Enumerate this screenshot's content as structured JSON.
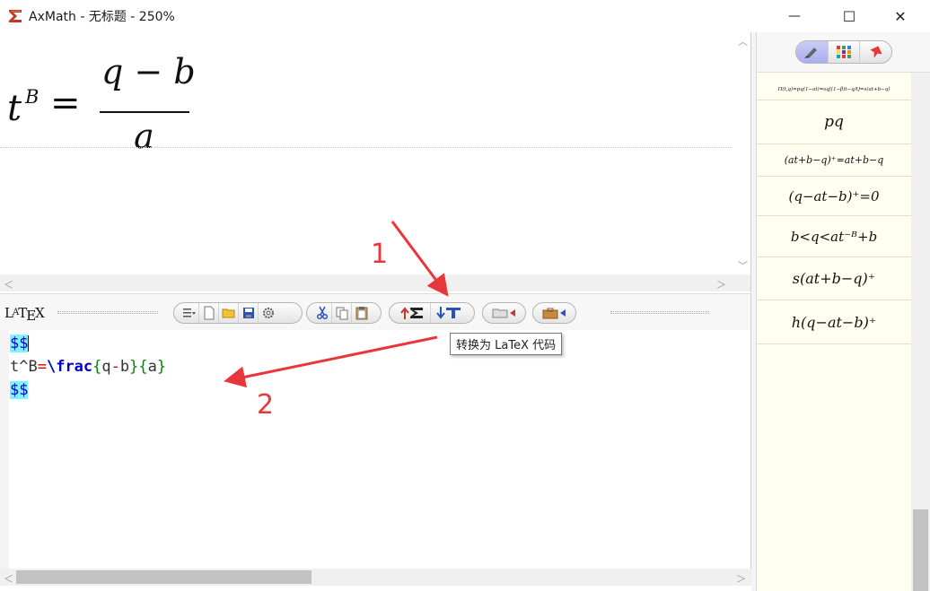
{
  "window": {
    "title": "AxMath - 无标题 - 250%",
    "minimize_glyph": "—",
    "maximize_glyph": "☐",
    "close_glyph": "✕"
  },
  "formula": {
    "base": "t",
    "superscript": "B",
    "equals": "=",
    "numerator": "q − b",
    "denominator": "a"
  },
  "latex_panel": {
    "logo_l": "L",
    "logo_a": "A",
    "logo_t": "T",
    "logo_e": "E",
    "logo_x": "X"
  },
  "toolbar": {
    "group1": [
      "menu-icon",
      "new-doc-icon",
      "open-folder-icon",
      "save-icon",
      "settings-gear-icon"
    ],
    "group2": [
      "cut-icon",
      "copy-icon",
      "paste-icon"
    ],
    "group3": [
      "import-to-formula-icon",
      "convert-to-latex-icon"
    ],
    "group4": [
      "folder-arrow-icon"
    ],
    "group5": [
      "toolbox-arrow-icon"
    ]
  },
  "editor": {
    "line1": "$$",
    "line2_base": "t^B",
    "line2_eq": "=",
    "line2_cmd": "\\frac",
    "line2_arg1_open": "{",
    "line2_arg1": "q",
    "line2_minus": "-",
    "line2_arg1_b": "b",
    "line2_arg1_close": "}",
    "line2_arg2_open": "{",
    "line2_arg2": "a",
    "line2_arg2_close": "}",
    "line3": "$$"
  },
  "tooltip": {
    "text": "转换为 LaTeX 代码"
  },
  "annotations": {
    "label1": "1",
    "label2": "2",
    "color": "#e8363a"
  },
  "sidebar": {
    "tabs": [
      "brush-icon",
      "grid-palette-icon",
      "bookmark-icon"
    ],
    "active_tab": 0,
    "items": [
      "Π(t,q)=pq(1−at)=sq[(1−β)t−q/t]=s(at+b−q)",
      "pq",
      "(at+b−q)⁺=at+b−q",
      "(q−at−b)⁺=0",
      "b<q<at⁻ᴮ+b",
      "s(at+b−q)⁺",
      "h(q−at−b)⁺"
    ]
  },
  "colors": {
    "latex_keyword": "#0000cc",
    "latex_brace": "#008800",
    "latex_operator": "#d00000",
    "dollar_highlight": "#7df3ff",
    "sidebar_bg": "#fffef0"
  }
}
